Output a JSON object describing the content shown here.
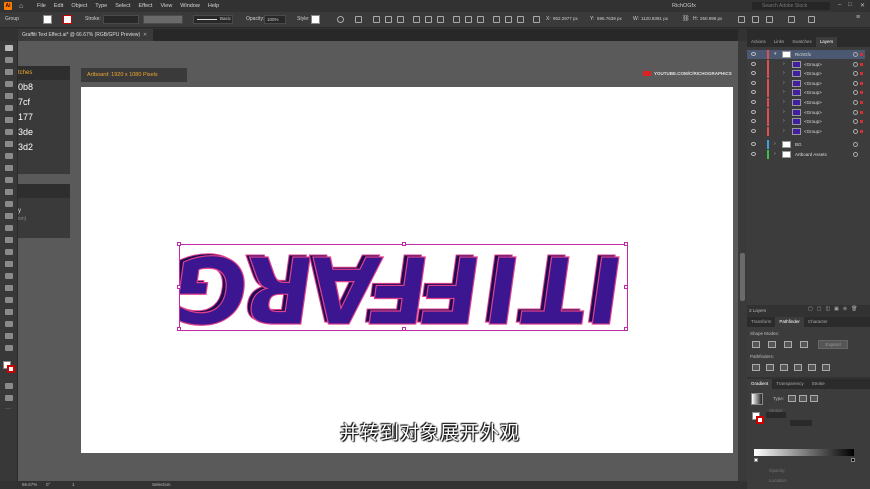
{
  "app": {
    "logo": "Ai",
    "user": "RichOGfx",
    "search_placeholder": "Search Adobe Stock"
  },
  "menu": [
    "File",
    "Edit",
    "Object",
    "Type",
    "Select",
    "Effect",
    "View",
    "Window",
    "Help"
  ],
  "control_bar": {
    "selection_label": "Group",
    "stroke_label": "Stroke:",
    "stroke_profile": "Basic",
    "opacity_label": "Opacity:",
    "opacity_value": "100%",
    "style_label": "Style:",
    "x_label": "X:",
    "x_value": "952.2977 px",
    "y_label": "Y:",
    "y_value": "596.7639 px",
    "w_label": "W:",
    "w_value": "1120.8391 px",
    "h_label": "H:",
    "h_value": "250.996 px"
  },
  "document": {
    "tab_title": "Graffiti Text Effect.ai* @ 66.67% (RGB/GPU Preview)",
    "artboard_label": "Artboard: 1920 x 1080 Pixels",
    "youtube_text": "YOUTUBE.COM/C/RICHOGRAPHICS",
    "subtitle": "并转到对象展开外观"
  },
  "swatches_panel": {
    "title": "tches",
    "items": [
      "0b8",
      "7cf",
      "177",
      "3de",
      "3d2"
    ],
    "sub_line1": "y",
    "sub_line2": "ion)"
  },
  "graffiti": {
    "text": "GRAFFITI"
  },
  "status_bar": {
    "zoom": "66.67%",
    "rotation": "0°",
    "page": "1",
    "mode": "Selection"
  },
  "panels": {
    "top_tabs": [
      "Actions",
      "Links",
      "Swatches",
      "Layers"
    ],
    "active_top_tab": "Layers",
    "layers": [
      {
        "name": "RichGfx",
        "color": "#e05050"
      },
      {
        "name": "<Group>",
        "color": "#e05050"
      },
      {
        "name": "<Group>",
        "color": "#e05050"
      },
      {
        "name": "<Group>",
        "color": "#e05050"
      },
      {
        "name": "<Group>",
        "color": "#e05050"
      },
      {
        "name": "<Group>",
        "color": "#e05050"
      },
      {
        "name": "<Group>",
        "color": "#e05050"
      },
      {
        "name": "<Group>",
        "color": "#e05050"
      },
      {
        "name": "<Group>",
        "color": "#e05050"
      },
      {
        "name": "BG",
        "color": "#3aa0e0"
      },
      {
        "name": "Artboard Assets",
        "color": "#40c040"
      }
    ],
    "layers_count": "3 Layers",
    "mid_tabs": [
      "Transform",
      "Pathfinder",
      "Character"
    ],
    "active_mid_tab": "Pathfinder",
    "shape_modes_label": "Shape Modes:",
    "expand_label": "Expand",
    "pathfinders_label": "Pathfinders:",
    "bottom_tabs": [
      "Gradient",
      "Transparency",
      "Stroke"
    ],
    "active_bottom_tab": "Gradient",
    "gradient_type_label": "Type:",
    "gradient_stroke_label": "Stroke:",
    "opacity_label": "Opacity:",
    "location_label": "Location:"
  },
  "colors": {
    "accent": "#f0a830",
    "selection": "#c02aa4",
    "letter_fill": "#3c1590",
    "letter_edge": "#e0408c"
  }
}
